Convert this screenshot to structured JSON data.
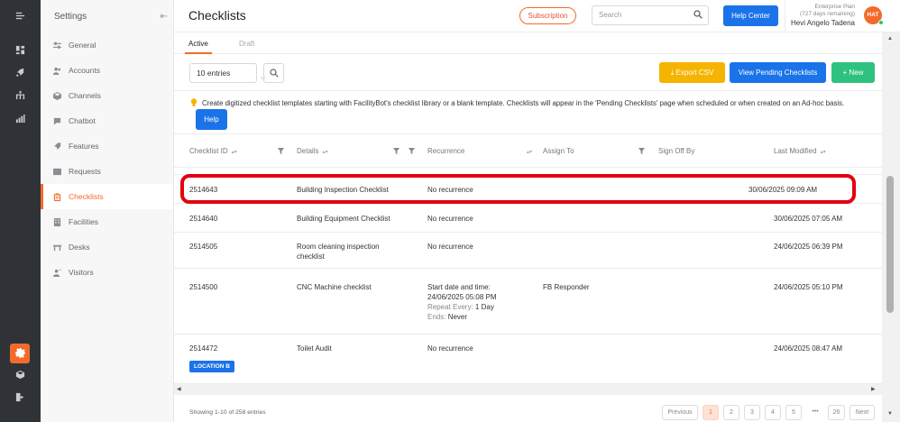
{
  "settings": {
    "title": "Settings",
    "items": [
      {
        "label": "General",
        "icon": "sliders-icon"
      },
      {
        "label": "Accounts",
        "icon": "users-icon"
      },
      {
        "label": "Channels",
        "icon": "cube-icon"
      },
      {
        "label": "Chatbot",
        "icon": "chat-icon"
      },
      {
        "label": "Features",
        "icon": "rocket-icon"
      },
      {
        "label": "Requests",
        "icon": "ticket-icon"
      },
      {
        "label": "Checklists",
        "icon": "clipboard-icon",
        "active": true
      },
      {
        "label": "Facilities",
        "icon": "building-icon"
      },
      {
        "label": "Desks",
        "icon": "desk-icon"
      },
      {
        "label": "Visitors",
        "icon": "visitor-icon"
      }
    ]
  },
  "header": {
    "title": "Checklists",
    "subscription_label": "Subscription",
    "search_placeholder": "Search",
    "help_center_label": "Help Center",
    "plan_name": "Enterprise Plan",
    "plan_remaining": "(727 days remaining)",
    "user_name": "Hevi Angelo Tadena",
    "avatar_initials": "HAT"
  },
  "tabs": {
    "active": "Active",
    "draft": "Draft"
  },
  "toolbar": {
    "entries_label": "10 entries",
    "export_label": "Export CSV",
    "pending_label": "View Pending Checklists",
    "new_label": "New"
  },
  "info": {
    "text": "Create digitized checklist templates starting with FacilityBot's checklist library or a blank template. Checklists will appear in the 'Pending Checklists' page when scheduled or when created on an Ad-hoc basis.",
    "help_label": "Help"
  },
  "table": {
    "headers": {
      "id": "Checklist ID",
      "details": "Details",
      "recurrence": "Recurrence",
      "assign_to": "Assign To",
      "sign_off_by": "Sign Off By",
      "last_modified": "Last Modified"
    },
    "rows": [
      {
        "id": "2514643",
        "details": "Building Inspection Checklist",
        "recurrence": "No recurrence",
        "assign_to": "",
        "sign_off_by": "",
        "last_modified": "30/06/2025 09:09 AM"
      },
      {
        "id": "2514640",
        "details": "Building Equipment Checklist",
        "recurrence": "No recurrence",
        "assign_to": "",
        "sign_off_by": "",
        "last_modified": "30/06/2025 07:05 AM"
      },
      {
        "id": "2514505",
        "details_line1": "Room cleaning inspection",
        "details_line2": "checklist",
        "recurrence": "No recurrence",
        "assign_to": "",
        "sign_off_by": "",
        "last_modified": "24/06/2025 06:39 PM"
      },
      {
        "id": "2514500",
        "details": "CNC Machine checklist",
        "rec_start_label": "Start date and time:",
        "rec_start_value": "24/06/2025 05:08 PM",
        "rec_repeat_label": "Repeat Every: ",
        "rec_repeat_value": "1 Day",
        "rec_ends_label": "Ends: ",
        "rec_ends_value": "Never",
        "assign_to": "FB Responder",
        "sign_off_by": "",
        "last_modified": "24/06/2025 05:10 PM"
      },
      {
        "id": "2514472",
        "details": "Toilet Audit",
        "recurrence": "No recurrence",
        "assign_to": "",
        "sign_off_by": "",
        "last_modified": "24/06/2025 08:47 AM",
        "badge": "LOCATION B"
      }
    ]
  },
  "footer": {
    "showing": "Showing 1-10 of 258 entries",
    "previous": "Previous",
    "pages": [
      "1",
      "2",
      "3",
      "4",
      "5"
    ],
    "ellipsis": "•••",
    "last_page": "26",
    "next": "Next"
  },
  "colors": {
    "accent": "#f26b2b",
    "primary": "#1a73e8",
    "warning": "#f5b400",
    "success": "#2ec27e",
    "highlight": "#e3000f"
  }
}
